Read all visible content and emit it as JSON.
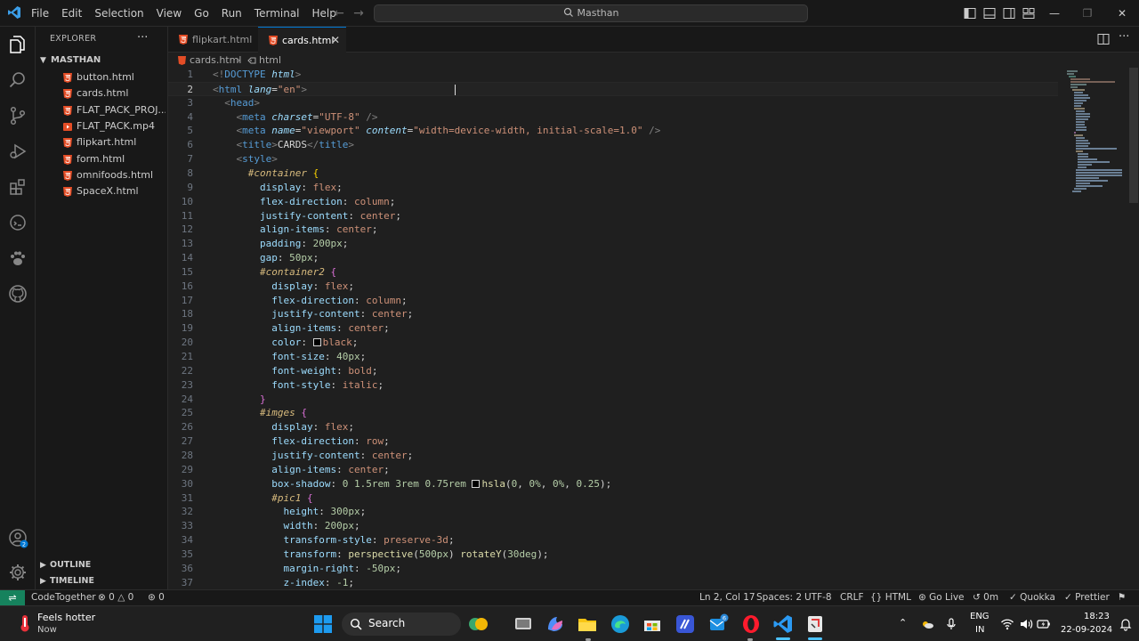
{
  "app": {
    "menu": [
      "File",
      "Edit",
      "Selection",
      "View",
      "Go",
      "Run",
      "Terminal",
      "Help"
    ],
    "search_label": "Masthan"
  },
  "colors": {
    "accent": "#0078d4",
    "html_icon": "#e44d26",
    "video_icon": "#e44d26",
    "remote": "#16825d"
  },
  "sidebar": {
    "title": "EXPLORER",
    "more": "···",
    "folder": "MASTHAN",
    "files": [
      {
        "name": "button.html",
        "icon": "html-file-icon"
      },
      {
        "name": "cards.html",
        "icon": "html-file-icon"
      },
      {
        "name": "FLAT_PACK_PROJ...",
        "icon": "html-file-icon"
      },
      {
        "name": "FLAT_PACK.mp4",
        "icon": "video-file-icon"
      },
      {
        "name": "flipkart.html",
        "icon": "html-file-icon"
      },
      {
        "name": "form.html",
        "icon": "html-file-icon"
      },
      {
        "name": "omnifoods.html",
        "icon": "html-file-icon"
      },
      {
        "name": "SpaceX.html",
        "icon": "html-file-icon"
      }
    ],
    "outline": "OUTLINE",
    "timeline": "TIMELINE"
  },
  "tabs": [
    {
      "label": "flipkart.html",
      "active": false
    },
    {
      "label": "cards.html",
      "active": true
    }
  ],
  "breadcrumb": {
    "file": "cards.html",
    "element": "html"
  },
  "editor": {
    "current_line": 2,
    "lines": [
      {
        "n": "1",
        "tokens": [
          [
            "p",
            "<!"
          ],
          [
            "t",
            "DOCTYPE"
          ],
          [
            "pl",
            " "
          ],
          [
            "a",
            "html"
          ],
          [
            "p",
            ">"
          ]
        ]
      },
      {
        "n": "2",
        "tokens": [
          [
            "p",
            "<"
          ],
          [
            "t",
            "html"
          ],
          [
            "pl",
            " "
          ],
          [
            "a",
            "lang"
          ],
          [
            "pl",
            "="
          ],
          [
            "s",
            "\"en\""
          ],
          [
            "p",
            ">"
          ]
        ]
      },
      {
        "n": "3",
        "tokens": [
          [
            "pl",
            "  "
          ],
          [
            "p",
            "<"
          ],
          [
            "t",
            "head"
          ],
          [
            "p",
            ">"
          ]
        ]
      },
      {
        "n": "4",
        "tokens": [
          [
            "pl",
            "    "
          ],
          [
            "p",
            "<"
          ],
          [
            "t",
            "meta"
          ],
          [
            "pl",
            " "
          ],
          [
            "a",
            "charset"
          ],
          [
            "pl",
            "="
          ],
          [
            "s",
            "\"UTF-8\""
          ],
          [
            "pl",
            " "
          ],
          [
            "p",
            "/>"
          ]
        ]
      },
      {
        "n": "5",
        "tokens": [
          [
            "pl",
            "    "
          ],
          [
            "p",
            "<"
          ],
          [
            "t",
            "meta"
          ],
          [
            "pl",
            " "
          ],
          [
            "a",
            "name"
          ],
          [
            "pl",
            "="
          ],
          [
            "s",
            "\"viewport\""
          ],
          [
            "pl",
            " "
          ],
          [
            "a",
            "content"
          ],
          [
            "pl",
            "="
          ],
          [
            "s",
            "\"width=device-width, initial-scale=1.0\""
          ],
          [
            "pl",
            " "
          ],
          [
            "p",
            "/>"
          ]
        ]
      },
      {
        "n": "6",
        "tokens": [
          [
            "pl",
            "    "
          ],
          [
            "p",
            "<"
          ],
          [
            "t",
            "title"
          ],
          [
            "p",
            ">"
          ],
          [
            "pl",
            "CARDS"
          ],
          [
            "p",
            "</"
          ],
          [
            "t",
            "title"
          ],
          [
            "p",
            ">"
          ]
        ]
      },
      {
        "n": "7",
        "tokens": [
          [
            "pl",
            "    "
          ],
          [
            "p",
            "<"
          ],
          [
            "t",
            "style"
          ],
          [
            "p",
            ">"
          ]
        ]
      },
      {
        "n": "8",
        "tokens": [
          [
            "pl",
            "      "
          ],
          [
            "sel",
            "#container"
          ],
          [
            "pl",
            " "
          ],
          [
            "b2",
            "{"
          ]
        ]
      },
      {
        "n": "9",
        "tokens": [
          [
            "pl",
            "        "
          ],
          [
            "pr",
            "display"
          ],
          [
            "pl",
            ": "
          ],
          [
            "v",
            "flex"
          ],
          [
            "pl",
            ";"
          ]
        ]
      },
      {
        "n": "10",
        "tokens": [
          [
            "pl",
            "        "
          ],
          [
            "pr",
            "flex-direction"
          ],
          [
            "pl",
            ": "
          ],
          [
            "v",
            "column"
          ],
          [
            "pl",
            ";"
          ]
        ]
      },
      {
        "n": "11",
        "tokens": [
          [
            "pl",
            "        "
          ],
          [
            "pr",
            "justify-content"
          ],
          [
            "pl",
            ": "
          ],
          [
            "v",
            "center"
          ],
          [
            "pl",
            ";"
          ]
        ]
      },
      {
        "n": "12",
        "tokens": [
          [
            "pl",
            "        "
          ],
          [
            "pr",
            "align-items"
          ],
          [
            "pl",
            ": "
          ],
          [
            "v",
            "center"
          ],
          [
            "pl",
            ";"
          ]
        ]
      },
      {
        "n": "13",
        "tokens": [
          [
            "pl",
            "        "
          ],
          [
            "pr",
            "padding"
          ],
          [
            "pl",
            ": "
          ],
          [
            "n",
            "200"
          ],
          [
            "u",
            "px"
          ],
          [
            "pl",
            ";"
          ]
        ]
      },
      {
        "n": "14",
        "tokens": [
          [
            "pl",
            "        "
          ],
          [
            "pr",
            "gap"
          ],
          [
            "pl",
            ": "
          ],
          [
            "n",
            "50"
          ],
          [
            "u",
            "px"
          ],
          [
            "pl",
            ";"
          ]
        ]
      },
      {
        "n": "15",
        "tokens": [
          [
            "pl",
            "        "
          ],
          [
            "sel",
            "#container2"
          ],
          [
            "pl",
            " "
          ],
          [
            "b",
            "{"
          ]
        ]
      },
      {
        "n": "16",
        "tokens": [
          [
            "pl",
            "          "
          ],
          [
            "pr",
            "display"
          ],
          [
            "pl",
            ": "
          ],
          [
            "v",
            "flex"
          ],
          [
            "pl",
            ";"
          ]
        ]
      },
      {
        "n": "17",
        "tokens": [
          [
            "pl",
            "          "
          ],
          [
            "pr",
            "flex-direction"
          ],
          [
            "pl",
            ": "
          ],
          [
            "v",
            "column"
          ],
          [
            "pl",
            ";"
          ]
        ]
      },
      {
        "n": "18",
        "tokens": [
          [
            "pl",
            "          "
          ],
          [
            "pr",
            "justify-content"
          ],
          [
            "pl",
            ": "
          ],
          [
            "v",
            "center"
          ],
          [
            "pl",
            ";"
          ]
        ]
      },
      {
        "n": "19",
        "tokens": [
          [
            "pl",
            "          "
          ],
          [
            "pr",
            "align-items"
          ],
          [
            "pl",
            ": "
          ],
          [
            "v",
            "center"
          ],
          [
            "pl",
            ";"
          ]
        ]
      },
      {
        "n": "20",
        "tokens": [
          [
            "pl",
            "          "
          ],
          [
            "pr",
            "color"
          ],
          [
            "pl",
            ": "
          ],
          [
            "sw",
            ""
          ],
          [
            "v",
            "black"
          ],
          [
            "pl",
            ";"
          ]
        ]
      },
      {
        "n": "21",
        "tokens": [
          [
            "pl",
            "          "
          ],
          [
            "pr",
            "font-size"
          ],
          [
            "pl",
            ": "
          ],
          [
            "n",
            "40"
          ],
          [
            "u",
            "px"
          ],
          [
            "pl",
            ";"
          ]
        ]
      },
      {
        "n": "22",
        "tokens": [
          [
            "pl",
            "          "
          ],
          [
            "pr",
            "font-weight"
          ],
          [
            "pl",
            ": "
          ],
          [
            "v",
            "bold"
          ],
          [
            "pl",
            ";"
          ]
        ]
      },
      {
        "n": "23",
        "tokens": [
          [
            "pl",
            "          "
          ],
          [
            "pr",
            "font-style"
          ],
          [
            "pl",
            ": "
          ],
          [
            "v",
            "italic"
          ],
          [
            "pl",
            ";"
          ]
        ]
      },
      {
        "n": "24",
        "tokens": [
          [
            "pl",
            "        "
          ],
          [
            "b",
            "}"
          ]
        ]
      },
      {
        "n": "25",
        "tokens": [
          [
            "pl",
            "        "
          ],
          [
            "sel",
            "#imges"
          ],
          [
            "pl",
            " "
          ],
          [
            "b",
            "{"
          ]
        ]
      },
      {
        "n": "26",
        "tokens": [
          [
            "pl",
            "          "
          ],
          [
            "pr",
            "display"
          ],
          [
            "pl",
            ": "
          ],
          [
            "v",
            "flex"
          ],
          [
            "pl",
            ";"
          ]
        ]
      },
      {
        "n": "27",
        "tokens": [
          [
            "pl",
            "          "
          ],
          [
            "pr",
            "flex-direction"
          ],
          [
            "pl",
            ": "
          ],
          [
            "v",
            "row"
          ],
          [
            "pl",
            ";"
          ]
        ]
      },
      {
        "n": "28",
        "tokens": [
          [
            "pl",
            "          "
          ],
          [
            "pr",
            "justify-content"
          ],
          [
            "pl",
            ": "
          ],
          [
            "v",
            "center"
          ],
          [
            "pl",
            ";"
          ]
        ]
      },
      {
        "n": "29",
        "tokens": [
          [
            "pl",
            "          "
          ],
          [
            "pr",
            "align-items"
          ],
          [
            "pl",
            ": "
          ],
          [
            "v",
            "center"
          ],
          [
            "pl",
            ";"
          ]
        ]
      },
      {
        "n": "30",
        "tokens": [
          [
            "pl",
            "          "
          ],
          [
            "pr",
            "box-shadow"
          ],
          [
            "pl",
            ": "
          ],
          [
            "n",
            "0"
          ],
          [
            "pl",
            " "
          ],
          [
            "n",
            "1.5"
          ],
          [
            "u",
            "rem"
          ],
          [
            "pl",
            " "
          ],
          [
            "n",
            "3"
          ],
          [
            "u",
            "rem"
          ],
          [
            "pl",
            " "
          ],
          [
            "n",
            "0.75"
          ],
          [
            "u",
            "rem"
          ],
          [
            "pl",
            " "
          ],
          [
            "sw",
            ""
          ],
          [
            "f",
            "hsla"
          ],
          [
            "pl",
            "("
          ],
          [
            "n",
            "0"
          ],
          [
            "pl",
            ", "
          ],
          [
            "n",
            "0"
          ],
          [
            "u",
            "%"
          ],
          [
            "pl",
            ", "
          ],
          [
            "n",
            "0"
          ],
          [
            "u",
            "%"
          ],
          [
            "pl",
            ", "
          ],
          [
            "n",
            "0.25"
          ],
          [
            "pl",
            ");"
          ]
        ]
      },
      {
        "n": "31",
        "tokens": [
          [
            "pl",
            "          "
          ],
          [
            "sel",
            "#pic1"
          ],
          [
            "pl",
            " "
          ],
          [
            "b",
            "{"
          ]
        ]
      },
      {
        "n": "32",
        "tokens": [
          [
            "pl",
            "            "
          ],
          [
            "pr",
            "height"
          ],
          [
            "pl",
            ": "
          ],
          [
            "n",
            "300"
          ],
          [
            "u",
            "px"
          ],
          [
            "pl",
            ";"
          ]
        ]
      },
      {
        "n": "33",
        "tokens": [
          [
            "pl",
            "            "
          ],
          [
            "pr",
            "width"
          ],
          [
            "pl",
            ": "
          ],
          [
            "n",
            "200"
          ],
          [
            "u",
            "px"
          ],
          [
            "pl",
            ";"
          ]
        ]
      },
      {
        "n": "34",
        "tokens": [
          [
            "pl",
            "            "
          ],
          [
            "pr",
            "transform-style"
          ],
          [
            "pl",
            ": "
          ],
          [
            "v",
            "preserve-3d"
          ],
          [
            "pl",
            ";"
          ]
        ]
      },
      {
        "n": "35",
        "tokens": [
          [
            "pl",
            "            "
          ],
          [
            "pr",
            "transform"
          ],
          [
            "pl",
            ": "
          ],
          [
            "f",
            "perspective"
          ],
          [
            "pl",
            "("
          ],
          [
            "n",
            "500"
          ],
          [
            "u",
            "px"
          ],
          [
            "pl",
            ") "
          ],
          [
            "f",
            "rotateY"
          ],
          [
            "pl",
            "("
          ],
          [
            "n",
            "30"
          ],
          [
            "u",
            "deg"
          ],
          [
            "pl",
            ");"
          ]
        ]
      },
      {
        "n": "36",
        "tokens": [
          [
            "pl",
            "            "
          ],
          [
            "pr",
            "margin-right"
          ],
          [
            "pl",
            ": "
          ],
          [
            "n",
            "-50"
          ],
          [
            "u",
            "px"
          ],
          [
            "pl",
            ";"
          ]
        ]
      },
      {
        "n": "37",
        "tokens": [
          [
            "pl",
            "            "
          ],
          [
            "pr",
            "z-index"
          ],
          [
            "pl",
            ": "
          ],
          [
            "n",
            "-1"
          ],
          [
            "pl",
            ";"
          ]
        ]
      }
    ]
  },
  "statusbar": {
    "codetogether": "CodeTogether",
    "errors": "0",
    "warnings": "0",
    "ports": "0",
    "position": "Ln 2, Col 17",
    "spaces": "Spaces: 2",
    "encoding": "UTF-8",
    "eol": "CRLF",
    "language": "HTML",
    "golive": "Go Live",
    "timer": "0m",
    "quokka": "Quokka",
    "prettier": "Prettier"
  },
  "taskbar": {
    "weather_title": "Feels hotter",
    "weather_sub": "Now",
    "search": "Search",
    "badge": "6",
    "lang1": "ENG",
    "lang2": "IN",
    "time": "18:23",
    "date": "22-09-2024",
    "account_badge": "2"
  }
}
